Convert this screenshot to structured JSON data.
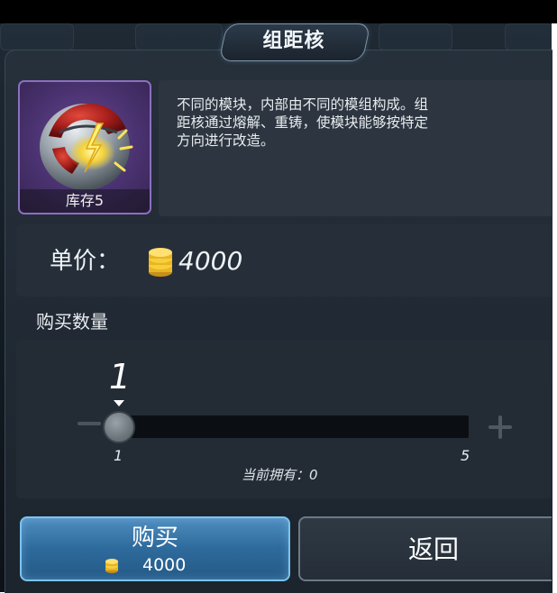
{
  "dialog": {
    "title": "组距核"
  },
  "item": {
    "icon": "red-silver-orb-with-lightning-icon",
    "stock_label": "库存5",
    "description": "不同的模块，内部由不同的模组构成。组\n距核通过熔解、重铸，使模块能够按特定\n方向进行改造。"
  },
  "price": {
    "label": "单价：",
    "value": "4000",
    "currency_icon": "gold-coin-stack-icon"
  },
  "quantity": {
    "label": "购买数量",
    "current": "1",
    "min": "1",
    "max": "5",
    "level": 0,
    "owned_text": "当前拥有：0"
  },
  "buttons": {
    "buy_label": "购买",
    "buy_price": "4000",
    "back_label": "返回"
  },
  "colors": {
    "buy_button": "#2e6a9c",
    "item_frame": "#8b6fbf",
    "coin": "#f2c12e"
  }
}
